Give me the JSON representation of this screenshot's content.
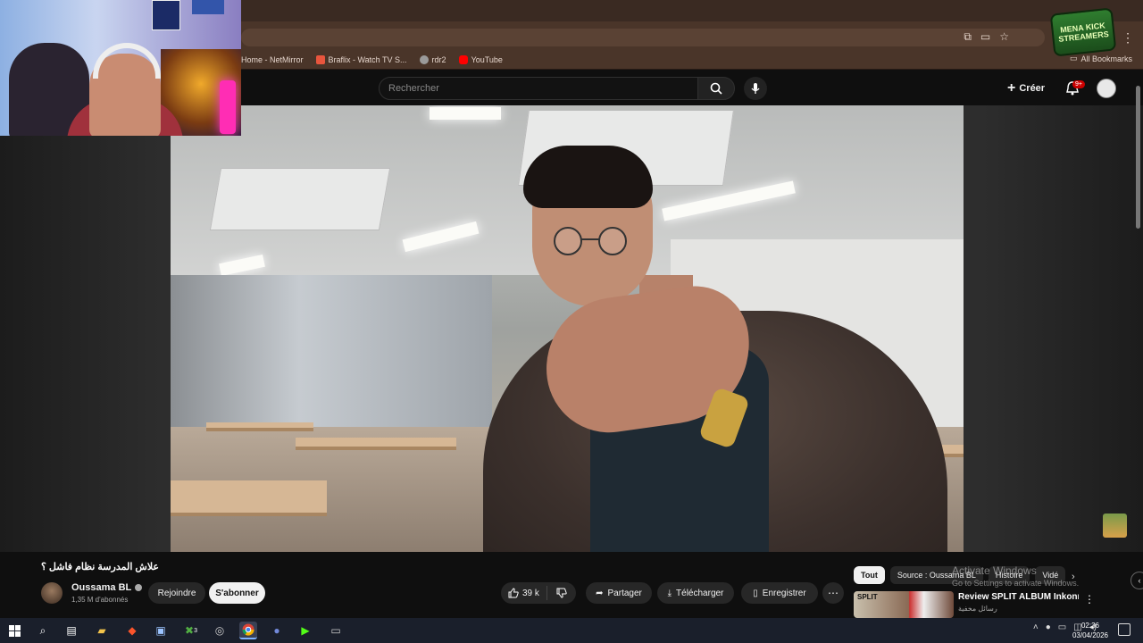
{
  "browser": {
    "bookmarks": [
      {
        "label": "Home - NetMirror",
        "color": "#e0e0e0"
      },
      {
        "label": "Braflix - Watch TV S...",
        "color": "#e8553d"
      },
      {
        "label": "rdr2",
        "color": "#9a9a9a"
      },
      {
        "label": "YouTube",
        "color": "#ff0000"
      }
    ],
    "all_bookmarks": "All Bookmarks"
  },
  "overlay": {
    "badge_text": "MENA KICK STREAMERS"
  },
  "youtube": {
    "search_placeholder": "Rechercher",
    "create_label": "Créer",
    "notifications_count": "9+"
  },
  "video": {
    "title": "علاش المدرسة نظام فاشل ؟",
    "channel_name": "Oussama BL",
    "subscribers": "1,35 M d'abonnés",
    "join_label": "Rejoindre",
    "subscribe_label": "S'abonner",
    "likes": "39 k",
    "share_label": "Partager",
    "download_label": "Télécharger",
    "save_label": "Enregistrer"
  },
  "recommendations": {
    "chips": [
      "Tout",
      "Source : Oussama BL",
      "Histoire",
      "Vidé"
    ],
    "items": [
      {
        "thumb_label": "SPLIT",
        "title": "Review SPLIT ALBUM Inkonnu |",
        "channel": "رسائل مخفية"
      }
    ]
  },
  "windows_watermark": {
    "line1": "Activate Windows",
    "line2": "Go to Settings to activate Windows."
  },
  "taskbar": {
    "time": "02:36",
    "date": "03/04/2026",
    "xbox_badge": "3"
  },
  "colors": {
    "accent": "#cc0000",
    "browser_frame": "#4a3529"
  }
}
